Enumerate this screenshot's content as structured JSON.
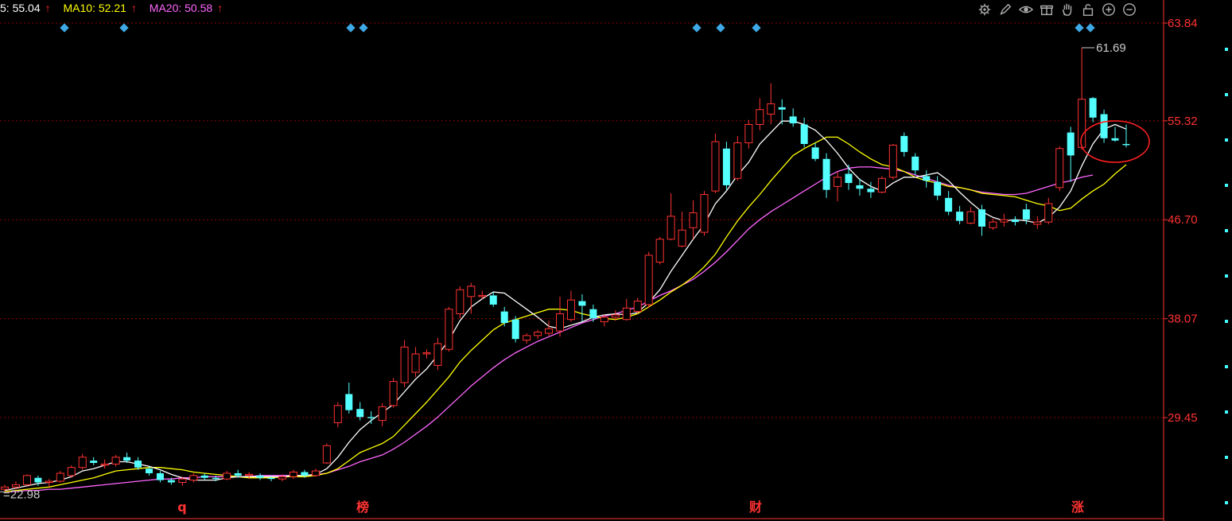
{
  "legend": [
    {
      "label": "5: 55.04",
      "arrow": "↑",
      "color": "#ffffff"
    },
    {
      "label": "MA10: 52.21",
      "arrow": "↑",
      "color": "#ffff00"
    },
    {
      "label": "MA20: 50.58",
      "arrow": "↑",
      "color": "#ff66ff"
    }
  ],
  "toolbar": [
    {
      "name": "settings-icon"
    },
    {
      "name": "pen-icon"
    },
    {
      "name": "eye-icon"
    },
    {
      "name": "gift-icon"
    },
    {
      "name": "hand-icon"
    },
    {
      "name": "lock-icon"
    },
    {
      "name": "zoom-in-icon"
    },
    {
      "name": "zoom-out-icon"
    }
  ],
  "chart_data": {
    "type": "candlestick",
    "y_ticks": [
      "63.84",
      "55.32",
      "46.70",
      "38.07",
      "29.45"
    ],
    "ylim": [
      21.5,
      65.5
    ],
    "max_label": "61.69",
    "min_label": "22.98",
    "bottom_markers": [
      "q",
      "榜",
      "财",
      "涨"
    ],
    "colors": {
      "up": "#ff3232",
      "down": "#54ffff",
      "ma5": "#ffffff",
      "ma10": "#ffff00",
      "ma20": "#ff66ff",
      "grid": "#8b0000",
      "axis": "#ff3232"
    },
    "candles": [
      [
        23.2,
        23.6,
        23.0,
        23.4
      ],
      [
        23.4,
        23.9,
        23.2,
        23.6
      ],
      [
        23.6,
        24.5,
        23.5,
        24.4
      ],
      [
        24.2,
        24.4,
        23.5,
        23.8
      ],
      [
        23.8,
        24.1,
        23.4,
        23.9
      ],
      [
        23.9,
        24.8,
        23.8,
        24.6
      ],
      [
        24.4,
        25.3,
        24.2,
        25.1
      ],
      [
        25.1,
        26.3,
        24.9,
        26.0
      ],
      [
        25.7,
        26.0,
        25.3,
        25.5
      ],
      [
        25.3,
        25.8,
        25.0,
        25.4
      ],
      [
        25.4,
        26.2,
        25.2,
        26.0
      ],
      [
        26.0,
        26.4,
        25.5,
        25.7
      ],
      [
        25.7,
        26.0,
        24.9,
        25.1
      ],
      [
        25.0,
        25.2,
        24.4,
        24.6
      ],
      [
        24.6,
        24.8,
        23.8,
        24.0
      ],
      [
        24.0,
        24.2,
        23.6,
        23.8
      ],
      [
        23.8,
        24.3,
        23.5,
        24.1
      ],
      [
        24.0,
        24.6,
        23.8,
        24.4
      ],
      [
        24.4,
        24.6,
        24.0,
        24.2
      ],
      [
        24.2,
        24.4,
        23.9,
        24.1
      ],
      [
        24.1,
        24.8,
        24.0,
        24.6
      ],
      [
        24.6,
        24.9,
        24.2,
        24.4
      ],
      [
        24.4,
        24.7,
        24.1,
        24.5
      ],
      [
        24.4,
        24.6,
        24.0,
        24.2
      ],
      [
        24.2,
        24.4,
        23.9,
        24.1
      ],
      [
        24.1,
        24.5,
        23.9,
        24.3
      ],
      [
        24.3,
        24.9,
        24.1,
        24.7
      ],
      [
        24.7,
        24.9,
        24.2,
        24.4
      ],
      [
        24.4,
        25.0,
        24.3,
        24.8
      ],
      [
        25.5,
        27.2,
        25.4,
        27.0
      ],
      [
        29.0,
        30.8,
        28.6,
        30.5
      ],
      [
        31.5,
        32.5,
        29.8,
        30.1
      ],
      [
        30.2,
        30.8,
        29.2,
        29.5
      ],
      [
        29.5,
        30.0,
        28.9,
        29.4
      ],
      [
        29.2,
        30.7,
        28.7,
        30.4
      ],
      [
        30.5,
        32.9,
        30.3,
        32.6
      ],
      [
        32.5,
        36.2,
        32.1,
        35.6
      ],
      [
        33.4,
        35.6,
        33.0,
        35.0
      ],
      [
        35.0,
        35.4,
        34.6,
        35.1
      ],
      [
        34.0,
        36.4,
        33.6,
        35.9
      ],
      [
        35.4,
        39.1,
        35.2,
        38.9
      ],
      [
        38.5,
        40.9,
        38.1,
        40.6
      ],
      [
        40.0,
        41.2,
        38.5,
        40.9
      ],
      [
        40.0,
        40.5,
        39.8,
        40.1
      ],
      [
        40.1,
        40.4,
        39.1,
        39.3
      ],
      [
        38.7,
        39.1,
        37.4,
        37.7
      ],
      [
        38.0,
        38.3,
        36.0,
        36.3
      ],
      [
        36.2,
        36.8,
        35.9,
        36.6
      ],
      [
        36.6,
        37.1,
        36.3,
        36.9
      ],
      [
        36.8,
        37.9,
        36.6,
        37.2
      ],
      [
        37.0,
        40.0,
        36.5,
        38.5
      ],
      [
        38.0,
        40.5,
        37.8,
        39.7
      ],
      [
        39.6,
        40.2,
        37.8,
        39.2
      ],
      [
        38.9,
        39.3,
        37.8,
        38.1
      ],
      [
        37.8,
        38.4,
        37.4,
        38.2
      ],
      [
        38.2,
        38.8,
        37.9,
        38.4
      ],
      [
        38.0,
        39.8,
        37.9,
        39.0
      ],
      [
        38.7,
        39.9,
        38.5,
        39.6
      ],
      [
        39.3,
        43.9,
        39.0,
        43.6
      ],
      [
        43.0,
        45.2,
        42.8,
        45.0
      ],
      [
        45.0,
        49.0,
        44.9,
        47.0
      ],
      [
        44.4,
        47.4,
        44.3,
        45.8
      ],
      [
        46.0,
        48.4,
        45.0,
        47.3
      ],
      [
        45.6,
        49.2,
        45.3,
        48.9
      ],
      [
        49.2,
        54.2,
        49.0,
        53.5
      ],
      [
        52.9,
        53.5,
        49.3,
        49.7
      ],
      [
        50.3,
        54.0,
        50.1,
        53.4
      ],
      [
        53.4,
        55.4,
        52.9,
        55.0
      ],
      [
        55.0,
        57.3,
        54.5,
        56.3
      ],
      [
        55.9,
        58.6,
        55.0,
        56.8
      ],
      [
        56.5,
        57.2,
        55.0,
        56.3
      ],
      [
        55.7,
        56.4,
        54.8,
        55.1
      ],
      [
        55.0,
        55.6,
        53.0,
        53.3
      ],
      [
        53.0,
        53.4,
        51.8,
        52.0
      ],
      [
        52.0,
        52.5,
        48.6,
        49.3
      ],
      [
        49.6,
        50.9,
        48.3,
        50.4
      ],
      [
        50.7,
        51.5,
        49.3,
        49.9
      ],
      [
        49.7,
        50.3,
        48.8,
        49.4
      ],
      [
        49.4,
        50.0,
        48.6,
        49.1
      ],
      [
        49.1,
        50.5,
        49.0,
        50.3
      ],
      [
        50.4,
        53.3,
        50.2,
        53.2
      ],
      [
        54.0,
        54.3,
        52.2,
        52.6
      ],
      [
        52.2,
        52.5,
        50.6,
        51.0
      ],
      [
        50.5,
        51.0,
        49.5,
        50.1
      ],
      [
        50.0,
        50.5,
        48.4,
        48.8
      ],
      [
        48.6,
        49.2,
        47.1,
        47.4
      ],
      [
        47.4,
        47.9,
        46.3,
        46.6
      ],
      [
        46.4,
        47.8,
        46.3,
        47.4
      ],
      [
        47.6,
        48.0,
        45.3,
        46.1
      ],
      [
        46.0,
        46.8,
        45.8,
        46.5
      ],
      [
        46.5,
        47.2,
        46.1,
        46.7
      ],
      [
        46.7,
        47.0,
        46.2,
        46.5
      ],
      [
        47.6,
        48.1,
        46.3,
        46.7
      ],
      [
        46.3,
        47.0,
        45.9,
        46.5
      ],
      [
        46.5,
        48.6,
        46.3,
        48.1
      ],
      [
        49.5,
        53.1,
        49.2,
        52.9
      ],
      [
        54.3,
        54.8,
        50.0,
        52.3
      ],
      [
        53.0,
        61.7,
        52.8,
        57.2
      ],
      [
        57.3,
        57.4,
        55.2,
        55.6
      ],
      [
        55.9,
        56.3,
        53.4,
        53.8
      ],
      [
        53.8,
        54.8,
        53.5,
        53.6
      ],
      [
        53.3,
        55.0,
        53.0,
        53.2
      ]
    ],
    "ma5": [
      23.1,
      23.3,
      23.5,
      23.7,
      23.8,
      24.0,
      24.3,
      24.8,
      25.0,
      25.3,
      25.6,
      25.6,
      25.4,
      25.2,
      24.9,
      24.5,
      24.2,
      24.0,
      24.0,
      24.0,
      24.2,
      24.3,
      24.3,
      24.3,
      24.3,
      24.3,
      24.4,
      24.4,
      24.5,
      25.0,
      26.0,
      27.3,
      28.4,
      29.2,
      29.9,
      30.6,
      31.7,
      32.8,
      33.7,
      34.9,
      36.2,
      37.9,
      39.1,
      39.8,
      40.4,
      40.3,
      39.6,
      38.9,
      38.2,
      37.4,
      37.2,
      37.5,
      37.8,
      38.2,
      38.4,
      38.5,
      38.4,
      38.6,
      39.5,
      40.6,
      42.2,
      43.6,
      45.0,
      46.3,
      48.1,
      49.2,
      50.6,
      51.7,
      53.3,
      54.3,
      55.3,
      55.3,
      55.0,
      54.5,
      53.6,
      52.5,
      51.2,
      50.2,
      49.6,
      49.2,
      49.9,
      50.4,
      50.4,
      50.6,
      50.8,
      50.1,
      49.1,
      48.2,
      47.4,
      46.9,
      46.6,
      46.7,
      46.6,
      46.4,
      46.9,
      47.8,
      49.2,
      51.4,
      53.3,
      54.6,
      55.0,
      54.6
    ],
    "ma10": [
      23.0,
      23.1,
      23.2,
      23.3,
      23.4,
      23.6,
      23.8,
      24.0,
      24.2,
      24.5,
      24.8,
      24.9,
      25.0,
      25.1,
      25.1,
      25.0,
      24.9,
      24.7,
      24.6,
      24.5,
      24.4,
      24.3,
      24.2,
      24.2,
      24.2,
      24.3,
      24.3,
      24.3,
      24.4,
      24.6,
      25.0,
      25.7,
      26.4,
      26.8,
      27.2,
      27.8,
      28.8,
      29.8,
      30.8,
      31.9,
      33.0,
      34.3,
      35.3,
      36.2,
      37.1,
      37.7,
      38.0,
      38.3,
      38.6,
      38.9,
      38.9,
      38.8,
      38.5,
      38.3,
      38.1,
      38.0,
      38.2,
      38.5,
      39.1,
      39.7,
      40.4,
      41.0,
      41.7,
      42.6,
      43.7,
      45.2,
      46.6,
      47.8,
      48.9,
      50.1,
      51.2,
      52.3,
      52.9,
      53.4,
      53.9,
      53.9,
      53.3,
      52.6,
      52.0,
      51.5,
      51.3,
      50.9,
      50.4,
      50.1,
      49.9,
      49.6,
      49.5,
      49.3,
      49.0,
      48.9,
      48.8,
      48.7,
      48.4,
      48.1,
      47.9,
      47.5,
      47.7,
      48.5,
      49.2,
      49.8,
      50.7,
      51.5
    ],
    "ma20": [
      23.0,
      23.0,
      23.1,
      23.1,
      23.2,
      23.2,
      23.3,
      23.4,
      23.5,
      23.6,
      23.7,
      23.8,
      23.9,
      24.0,
      24.1,
      24.1,
      24.2,
      24.2,
      24.3,
      24.3,
      24.3,
      24.3,
      24.3,
      24.4,
      24.4,
      24.4,
      24.4,
      24.4,
      24.5,
      24.6,
      24.9,
      25.2,
      25.6,
      25.9,
      26.2,
      26.7,
      27.3,
      28.0,
      28.7,
      29.5,
      30.4,
      31.3,
      32.2,
      33.0,
      33.8,
      34.5,
      35.1,
      35.6,
      36.1,
      36.5,
      36.9,
      37.3,
      37.7,
      38.0,
      38.3,
      38.5,
      38.8,
      39.1,
      39.6,
      40.1,
      40.5,
      41.0,
      41.5,
      42.2,
      43.0,
      43.9,
      44.9,
      45.9,
      46.7,
      47.4,
      48.0,
      48.6,
      49.2,
      49.8,
      50.4,
      50.9,
      51.2,
      51.3,
      51.3,
      51.2,
      51.1,
      50.9,
      50.6,
      50.3,
      50.0,
      49.7,
      49.5,
      49.3,
      49.1,
      49.0,
      48.9,
      48.9,
      49.0,
      49.3,
      49.6,
      49.9,
      50.1,
      50.4,
      50.6
    ]
  }
}
